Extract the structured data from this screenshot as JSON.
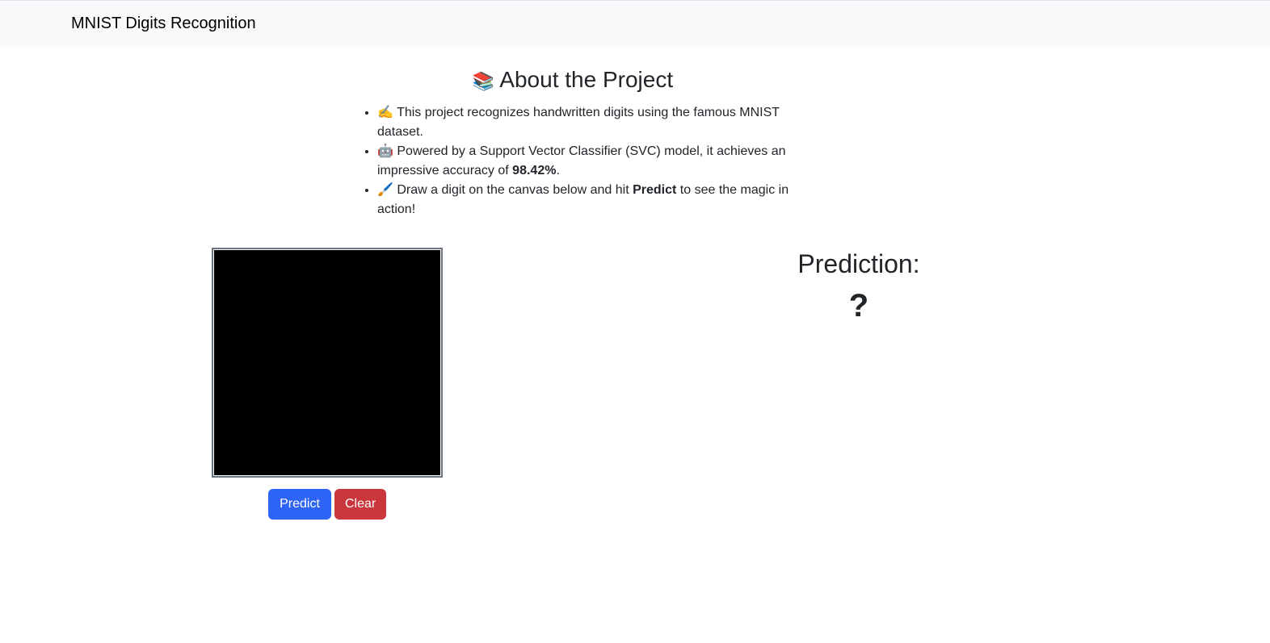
{
  "navbar": {
    "brand": "MNIST Digits Recognition"
  },
  "about": {
    "title_emoji": "📚",
    "title": "About the Project",
    "items": [
      {
        "emoji": "✍️",
        "text": "This project recognizes handwritten digits using the famous MNIST dataset."
      },
      {
        "emoji": "🤖",
        "text_before": "Powered by a Support Vector Classifier (SVC) model, it achieves an impressive accuracy of ",
        "accuracy": "98.42%",
        "text_after": "."
      },
      {
        "emoji": "🖌️",
        "text_before": "Draw a digit on the canvas below and hit ",
        "bold": "Predict",
        "text_after": " to see the magic in action!"
      }
    ]
  },
  "canvas": {
    "background_color": "#000000"
  },
  "buttons": {
    "predict_label": "Predict",
    "clear_label": "Clear",
    "predict_color": "#2d64f5",
    "clear_color": "#c9373d"
  },
  "prediction": {
    "title": "Prediction:",
    "value": "?"
  }
}
